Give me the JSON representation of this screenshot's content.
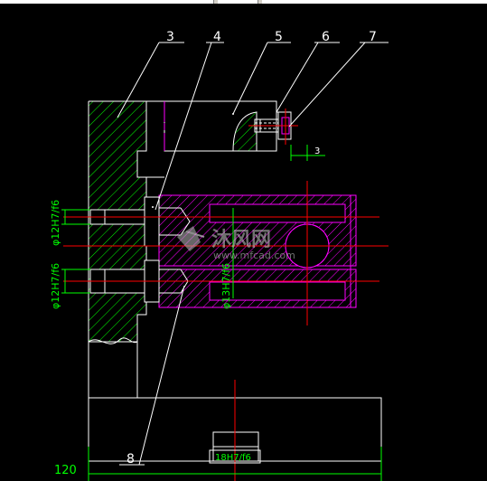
{
  "colors": {
    "background": "#000000",
    "outline": "#ffffff",
    "hatch": "#00ff00",
    "part": "#ff00ff",
    "centerline": "#ff0000",
    "dimension": "#00ff00"
  },
  "callouts": {
    "c3": "3",
    "c4": "4",
    "c5": "5",
    "c6": "6",
    "c7": "7",
    "c8": "8"
  },
  "dimensions": {
    "gap": "3",
    "hole_top": "φ12H7/f6",
    "hole_bottom": "φ12H7/f6",
    "bore_mid": "φ13H7/f6",
    "slot": "18H7/f6",
    "width": "120"
  },
  "watermark": {
    "brand": "沐风网",
    "url": "www.mfcad.com"
  }
}
